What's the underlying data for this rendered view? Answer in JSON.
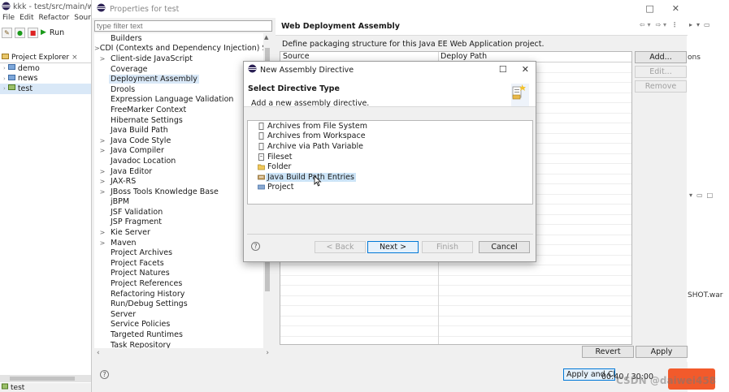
{
  "eclipse": {
    "title": "kkk - test/src/main/web",
    "menu": [
      "File",
      "Edit",
      "Refactor",
      "Source"
    ],
    "run_label": "Run",
    "explorer_tab": "Project Explorer",
    "explorer_close": "×",
    "projects": [
      "demo",
      "news",
      "test"
    ],
    "status": "test",
    "right_snip_1": "ons",
    "right_snip_2": "SHOT.war"
  },
  "properties": {
    "title": "Properties for test",
    "filter_placeholder": "type filter text",
    "tree": [
      {
        "label": "Builders",
        "arrow": ""
      },
      {
        "label": "CDI (Contexts and Dependency Injection) Setti",
        "arrow": ">"
      },
      {
        "label": "Client-side JavaScript",
        "arrow": ">"
      },
      {
        "label": "Coverage",
        "arrow": ""
      },
      {
        "label": "Deployment Assembly",
        "arrow": ""
      },
      {
        "label": "Drools",
        "arrow": ""
      },
      {
        "label": "Expression Language Validation",
        "arrow": ""
      },
      {
        "label": "FreeMarker Context",
        "arrow": ""
      },
      {
        "label": "Hibernate Settings",
        "arrow": ""
      },
      {
        "label": "Java Build Path",
        "arrow": ""
      },
      {
        "label": "Java Code Style",
        "arrow": ">"
      },
      {
        "label": "Java Compiler",
        "arrow": ">"
      },
      {
        "label": "Javadoc Location",
        "arrow": ""
      },
      {
        "label": "Java Editor",
        "arrow": ">"
      },
      {
        "label": "JAX-RS",
        "arrow": ">"
      },
      {
        "label": "JBoss Tools Knowledge Base",
        "arrow": ">"
      },
      {
        "label": "jBPM",
        "arrow": ""
      },
      {
        "label": "JSF Validation",
        "arrow": ""
      },
      {
        "label": "JSP Fragment",
        "arrow": ""
      },
      {
        "label": "Kie Server",
        "arrow": ">"
      },
      {
        "label": "Maven",
        "arrow": ">"
      },
      {
        "label": "Project Archives",
        "arrow": ""
      },
      {
        "label": "Project Facets",
        "arrow": ""
      },
      {
        "label": "Project Natures",
        "arrow": ""
      },
      {
        "label": "Project References",
        "arrow": ""
      },
      {
        "label": "Refactoring History",
        "arrow": ""
      },
      {
        "label": "Run/Debug Settings",
        "arrow": ""
      },
      {
        "label": "Server",
        "arrow": ""
      },
      {
        "label": "Service Policies",
        "arrow": ""
      },
      {
        "label": "Targeted Runtimes",
        "arrow": ""
      },
      {
        "label": "Task Repository",
        "arrow": ""
      }
    ],
    "panel_title": "Web Deployment Assembly",
    "panel_desc": "Define packaging structure for this Java EE Web Application project.",
    "col_source": "Source",
    "col_deploy": "Deploy Path",
    "add_label": "Add...",
    "edit_label": "Edit...",
    "remove_label": "Remove",
    "revert_label": "Revert",
    "apply_label": "Apply",
    "apply_close_label": "Apply and Close",
    "help_glyph": "?"
  },
  "modal": {
    "title": "New Assembly Directive",
    "heading": "Select Directive Type",
    "subheading": "Add a new assembly directive.",
    "items": [
      "Archives from File System",
      "Archives from Workspace",
      "Archive via Path Variable",
      "Fileset",
      "Folder",
      "Java Build Path Entries",
      "Project"
    ],
    "back_label": "< Back",
    "next_label": "Next >",
    "finish_label": "Finish",
    "cancel_label": "Cancel"
  },
  "video": {
    "time": "00:40 / 30:00",
    "watermark": "CSDN @daiwei458"
  },
  "colors": {
    "selection": "#d9e8f7",
    "highlight": "#cce4f7",
    "default_button_border": "#0078d7",
    "video_orange": "#f25a2b"
  }
}
